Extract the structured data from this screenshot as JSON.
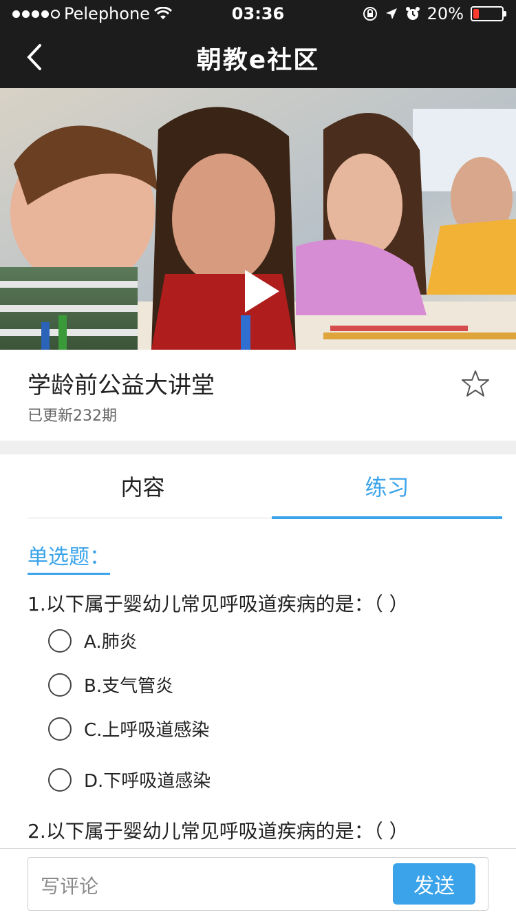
{
  "status_bar": {
    "carrier": "Pelephone",
    "time": "03:36",
    "battery_percent": "20%",
    "battery_level": 0.2
  },
  "nav": {
    "title": "朝教e社区"
  },
  "course": {
    "title": "学龄前公益大讲堂",
    "update_text": "已更新232期"
  },
  "tabs": [
    {
      "label": "内容",
      "active": false
    },
    {
      "label": "练习",
      "active": true
    }
  ],
  "practice": {
    "section_title": "单选题：",
    "questions": [
      {
        "text": "1.以下属于婴幼儿常见呼吸道疾病的是：（    ）",
        "options": [
          "A.肺炎",
          "B.支气管炎",
          "C.上呼吸道感染",
          "D.下呼吸道感染"
        ]
      },
      {
        "text": "2.以下属于婴幼儿常见呼吸道疾病的是：（    ）",
        "options": []
      }
    ]
  },
  "comment": {
    "placeholder": "写评论",
    "send_label": "发送"
  },
  "colors": {
    "accent": "#3aa3ea",
    "topbar": "#1c1c1c",
    "battery_low": "#ff3b30"
  }
}
